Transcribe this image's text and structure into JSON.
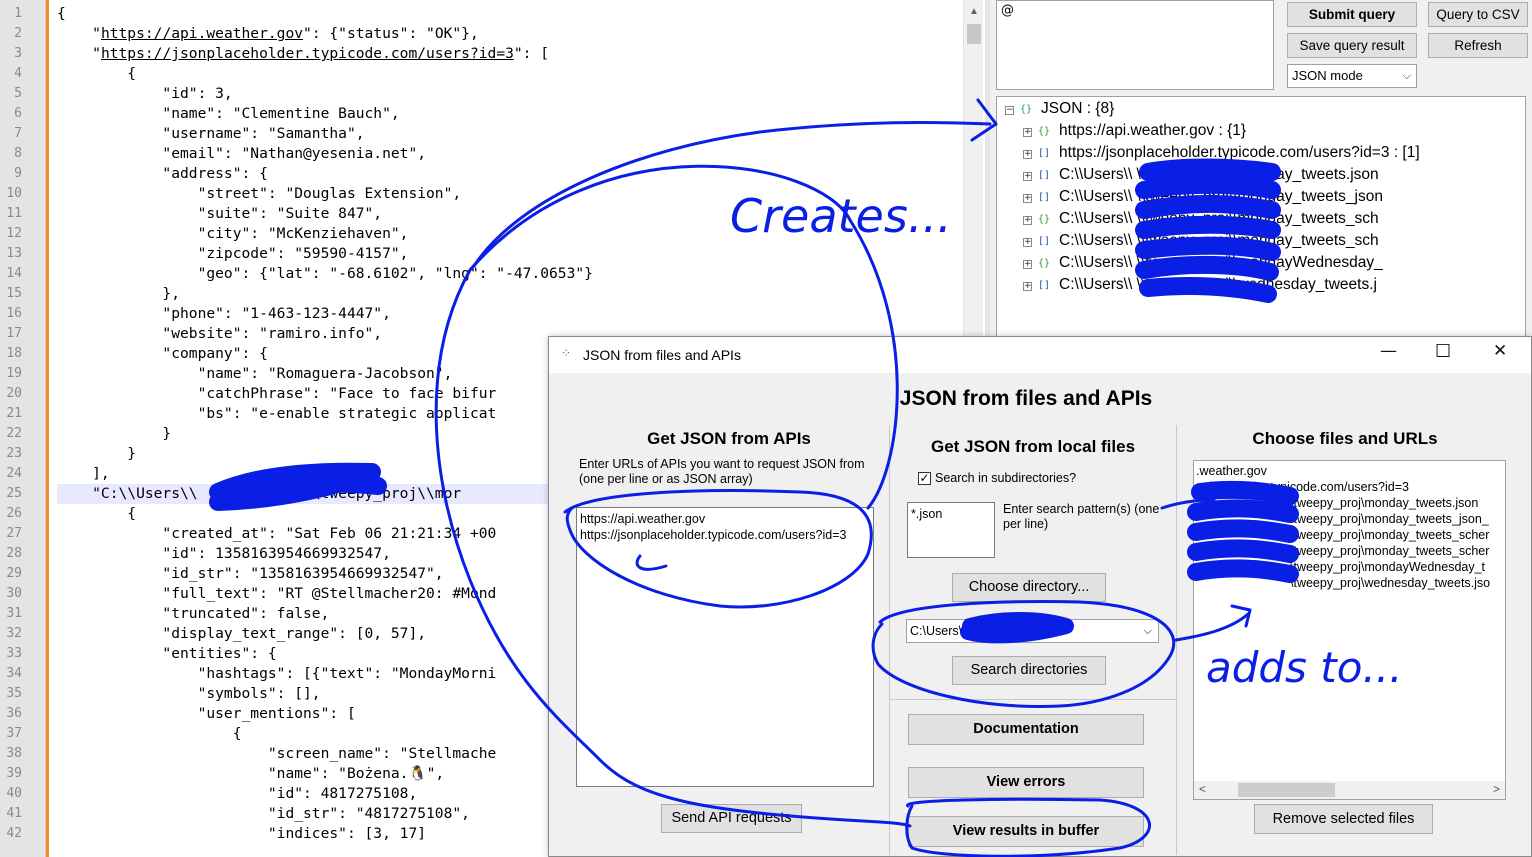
{
  "editor": {
    "line_numbers": [
      "1",
      "2",
      "3",
      "4",
      "5",
      "6",
      "7",
      "8",
      "9",
      "10",
      "11",
      "12",
      "13",
      "14",
      "15",
      "16",
      "17",
      "18",
      "19",
      "20",
      "21",
      "22",
      "23",
      "24",
      "25",
      "26",
      "27",
      "28",
      "29",
      "30",
      "31",
      "32",
      "33",
      "34",
      "35",
      "36",
      "37",
      "38",
      "39",
      "40",
      "41",
      "42"
    ],
    "lines": [
      "{",
      "    \"https://api.weather.gov\": {\"status\": \"OK\"},",
      "    \"https://jsonplaceholder.typicode.com/users?id=3\": [",
      "        {",
      "            \"id\": 3,",
      "            \"name\": \"Clementine Bauch\",",
      "            \"username\": \"Samantha\",",
      "            \"email\": \"Nathan@yesenia.net\",",
      "            \"address\": {",
      "                \"street\": \"Douglas Extension\",",
      "                \"suite\": \"Suite 847\",",
      "                \"city\": \"McKenziehaven\",",
      "                \"zipcode\": \"59590-4157\",",
      "                \"geo\": {\"lat\": \"-68.6102\", \"lng\": \"-47.0653\"}",
      "            },",
      "            \"phone\": \"1-463-123-4447\",",
      "            \"website\": \"ramiro.info\",",
      "            \"company\": {",
      "                \"name\": \"Romaguera-Jacobson\",",
      "                \"catchPhrase\": \"Face to face bifur",
      "                \"bs\": \"e-enable strategic applicat",
      "            }",
      "        }",
      "    ],",
      "    \"C:\\\\Users\\\\            \\\\tweepy_proj\\\\mor",
      "        {",
      "            \"created_at\": \"Sat Feb 06 21:21:34 +00",
      "            \"id\": 1358163954669932547,",
      "            \"id_str\": \"1358163954669932547\",",
      "            \"full_text\": \"RT @Stellmacher20: #Mond",
      "            \"truncated\": false,",
      "            \"display_text_range\": [0, 57],",
      "            \"entities\": {",
      "                \"hashtags\": [{\"text\": \"MondayMorni",
      "                \"symbols\": [],",
      "                \"user_mentions\": [",
      "                    {",
      "                        \"screen_name\": \"Stellmache",
      "                        \"name\": \"Bożena.🐧\",",
      "                        \"id\": 4817275108,",
      "                        \"id_str\": \"4817275108\",",
      "                        \"indices\": [3, 17]"
    ]
  },
  "right": {
    "query_text": "@",
    "submit_query": "Submit query",
    "query_to_csv": "Query to CSV",
    "save_query_result": "Save query result",
    "refresh": "Refresh",
    "mode_select": "JSON mode",
    "tree": {
      "root": "JSON : {8}",
      "nodes": [
        "https://api.weather.gov : {1}",
        "https://jsonplaceholder.typicode.com/users?id=3 : [1]",
        "C:\\\\Users\\\\            \\\\tweepy_proj\\\\monday_tweets.json",
        "C:\\\\Users\\\\            \\\\tweepy_proj\\\\monday_tweets_json",
        "C:\\\\Users\\\\            \\\\tweepy_proj\\\\monday_tweets_sch",
        "C:\\\\Users\\\\            \\\\tweepy_proj\\\\monday_tweets_sch",
        "C:\\\\Users\\\\            \\\\tweepy_proj\\\\mondayWednesday_",
        "C:\\\\Users\\\\            \\\\tweepy_proj\\\\wednesday_tweets.j"
      ]
    }
  },
  "dialog": {
    "title": "JSON from files and APIs",
    "heading": "JSON from files and APIs",
    "apis": {
      "title": "Get JSON from APIs",
      "instructions": "Enter URLs of APIs you want to request JSON from (one per line or as JSON array)",
      "urls_text": "https://api.weather.gov\nhttps://jsonplaceholder.typicode.com/users?id=3",
      "send_button": "Send API requests"
    },
    "local": {
      "title": "Get JSON from local files",
      "search_subdirs": "Search in subdirectories?",
      "pattern_value": "*.json",
      "pattern_label": "Enter search pattern(s) (one per line)",
      "choose_dir": "Choose directory...",
      "dir_value": "C:\\Users\\                     \\tweepy_pro",
      "search_dirs": "Search directories",
      "documentation": "Documentation",
      "view_errors": "View errors",
      "view_results": "View results in buffer"
    },
    "files": {
      "title": "Choose files and URLs",
      "items": [
        ".weather.gov",
        "nplaceholder.typicode.com/users?id=3",
        "\\tweepy_proj\\monday_tweets.json",
        "\\tweepy_proj\\monday_tweets_json_",
        "\\tweepy_proj\\monday_tweets_scher",
        "\\tweepy_proj\\monday_tweets_scher",
        "\\tweepy_proj\\mondayWednesday_t",
        "\\tweepy_proj\\wednesday_tweets.jso"
      ],
      "remove_button": "Remove selected files"
    }
  },
  "annotations": {
    "creates": "Creates...",
    "adds_to": "adds to..."
  },
  "colors": {
    "ink": "#0a1fe6",
    "change_bar": "#f28c28",
    "tree_object_icon": "#2a9a3a",
    "tree_array_icon": "#1b4fa0"
  }
}
